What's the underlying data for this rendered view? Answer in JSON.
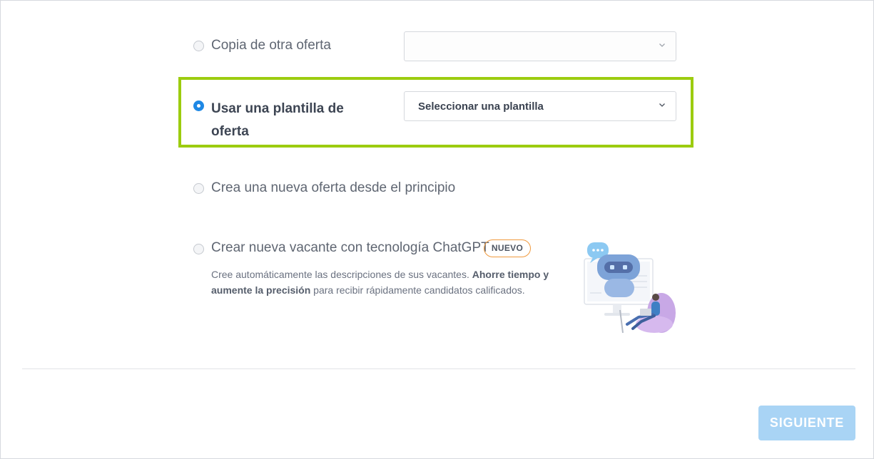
{
  "options": {
    "copy": {
      "label": "Copia de otra oferta",
      "select_value": ""
    },
    "template": {
      "label_line1": "Usar una plantilla de",
      "label_line2": "oferta",
      "select_value": "Seleccionar una plantilla"
    },
    "new": {
      "label": "Crea una nueva oferta desde el principio"
    },
    "chatgpt": {
      "label": "Crear nueva vacante con tecnología ChatGPT",
      "badge": "NUEVO",
      "desc_part1": "Cree automáticamente las descripciones de sus vacantes.",
      "desc_bold": "Ahorre tiempo y aumente la precisión",
      "desc_part2": "para recibir rápidamente candidatos calificados."
    }
  },
  "footer": {
    "next_label": "SIGUIENTE"
  },
  "colors": {
    "accent": "#1e88e5",
    "highlight": "#9ccc0f",
    "badge_border": "#f09a3e",
    "next_button": "#a9d4f5"
  },
  "icons": [
    "chevron-down-icon",
    "chat-bubble-icon",
    "robot-icon",
    "monitor-icon",
    "person-laptop-icon",
    "beanbag-icon"
  ]
}
